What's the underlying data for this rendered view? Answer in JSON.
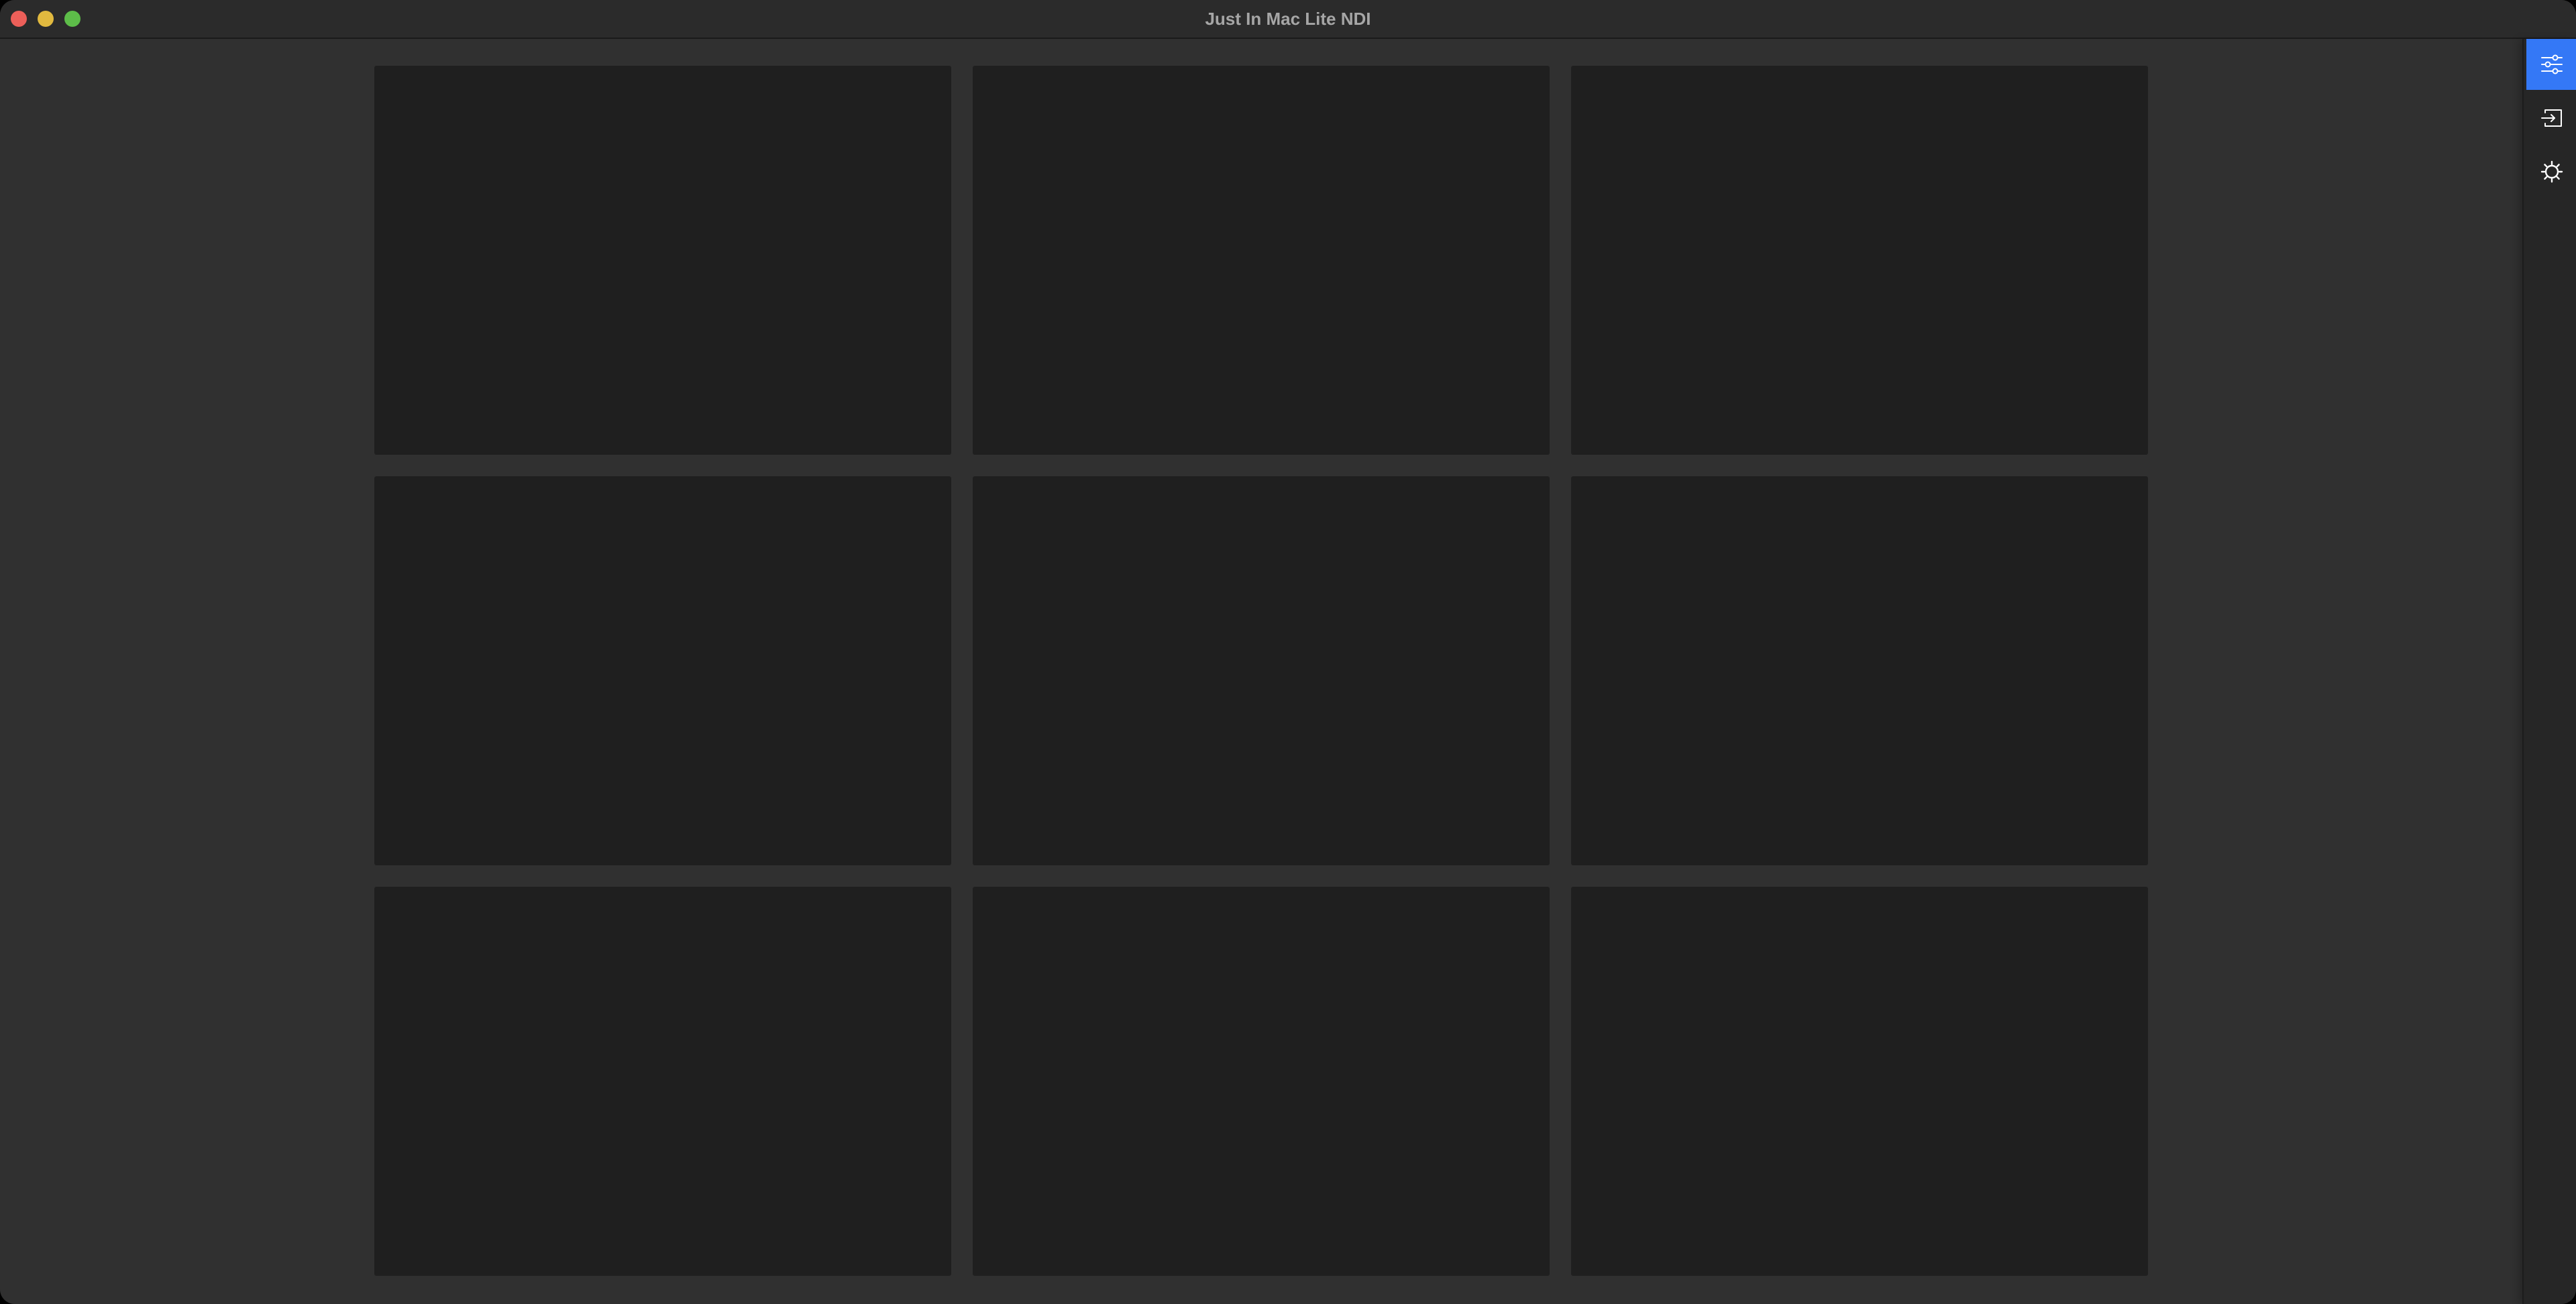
{
  "window": {
    "title": "Just In Mac Lite NDI",
    "traffic_colors": {
      "close": "#ec5f59",
      "minimize": "#e1b93f",
      "zoom": "#5dbd49"
    }
  },
  "grid": {
    "tile_count": 9,
    "tile_color": "#1f1f1f",
    "background_color": "#303030"
  },
  "sidebar": {
    "accent_color": "#3478f6",
    "items": [
      {
        "icon": "sliders-icon",
        "active": true
      },
      {
        "icon": "input-icon",
        "active": false
      },
      {
        "icon": "gear-icon",
        "active": false
      }
    ]
  }
}
